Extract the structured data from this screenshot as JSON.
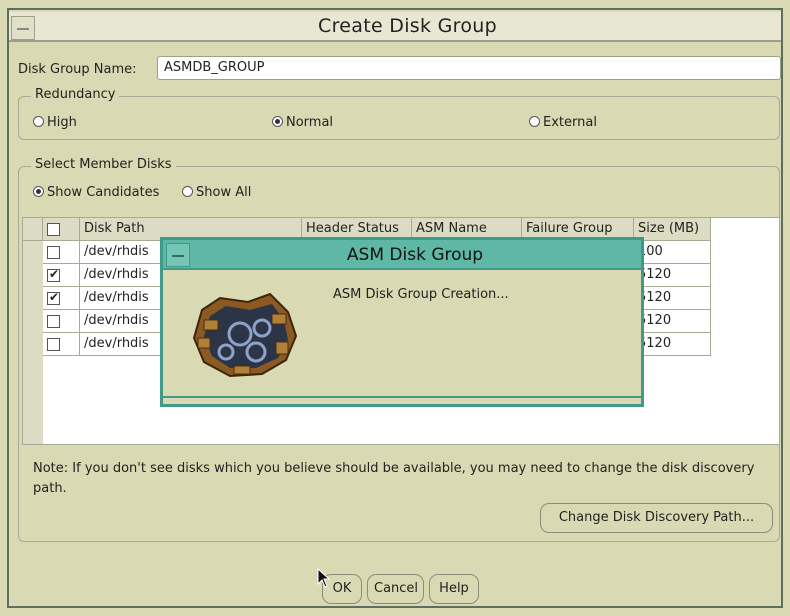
{
  "window": {
    "title": "Create Disk Group"
  },
  "disk_group_name": {
    "label": "Disk Group Name:",
    "value": "ASMDB_GROUP"
  },
  "redundancy": {
    "legend": "Redundancy",
    "options": [
      {
        "label": "High",
        "selected": false
      },
      {
        "label": "Normal",
        "selected": true
      },
      {
        "label": "External",
        "selected": false
      }
    ]
  },
  "member_disks": {
    "legend": "Select Member Disks",
    "filter_options": [
      {
        "label": "Show Candidates",
        "selected": true
      },
      {
        "label": "Show All",
        "selected": false
      }
    ]
  },
  "table": {
    "columns": [
      "Disk Path",
      "Header Status",
      "ASM Name",
      "Failure Group",
      "Size (MB)"
    ],
    "rows": [
      {
        "checked": false,
        "disk_path": "/dev/rhdis",
        "size": "100"
      },
      {
        "checked": true,
        "disk_path": "/dev/rhdis",
        "size": "5120"
      },
      {
        "checked": true,
        "disk_path": "/dev/rhdis",
        "size": "5120"
      },
      {
        "checked": false,
        "disk_path": "/dev/rhdis",
        "size": "5120"
      },
      {
        "checked": false,
        "disk_path": "/dev/rhdis",
        "size": "5120"
      }
    ]
  },
  "note": "Note: If you don't see disks which you believe should be available, you may need to change the disk discovery path.",
  "buttons": {
    "change_path": "Change Disk Discovery Path...",
    "ok": "OK",
    "cancel": "Cancel",
    "help": "Help"
  },
  "dialog": {
    "title": "ASM Disk Group",
    "message": "ASM Disk Group Creation...",
    "icon": "asm-creation-icon"
  },
  "colors": {
    "background": "#d9d9b3",
    "dialog_title": "#5fb8a6",
    "dialog_border": "#3f9a8a"
  }
}
